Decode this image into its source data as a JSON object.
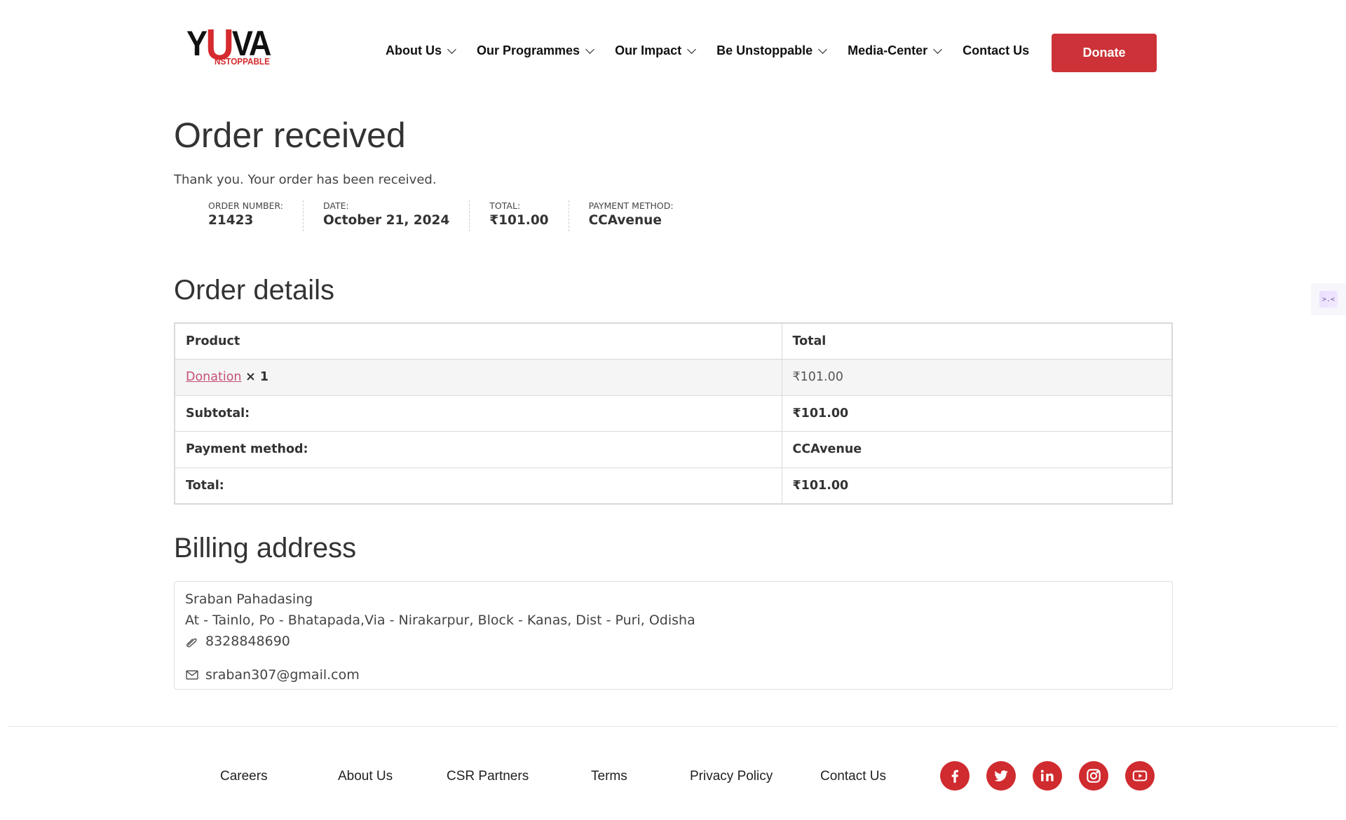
{
  "brand": {
    "logo_main": "YUVA",
    "logo_sub": "NSTOPPABLE",
    "accent_color": "#cc3237"
  },
  "nav": {
    "items": [
      {
        "label": "About Us",
        "dropdown": true
      },
      {
        "label": "Our Programmes",
        "dropdown": true
      },
      {
        "label": "Our Impact",
        "dropdown": true
      },
      {
        "label": "Be Unstoppable",
        "dropdown": true
      },
      {
        "label": "Media-Center",
        "dropdown": true
      },
      {
        "label": "Contact Us",
        "dropdown": false
      }
    ],
    "donate_label": "Donate"
  },
  "order": {
    "title": "Order received",
    "thanks": "Thank you. Your order has been received.",
    "overview": {
      "number_label": "ORDER NUMBER:",
      "number": "21423",
      "date_label": "DATE:",
      "date": "October 21, 2024",
      "total_label": "TOTAL:",
      "total": "₹101.00",
      "payment_label": "PAYMENT METHOD:",
      "payment": "CCAvenue"
    }
  },
  "details": {
    "heading": "Order details",
    "col_product": "Product",
    "col_total": "Total",
    "item": {
      "name": "Donation",
      "qty": "× 1",
      "total": "₹101.00"
    },
    "subtotal_label": "Subtotal:",
    "subtotal": "₹101.00",
    "payment_label": "Payment method:",
    "payment": "CCAvenue",
    "total_label": "Total:",
    "total": "₹101.00"
  },
  "billing": {
    "heading": "Billing address",
    "name": "Sraban Pahadasing",
    "address": "At - Tainlo, Po - Bhatapada,Via - Nirakarpur, Block - Kanas, Dist - Puri, Odisha",
    "phone": "8328848690",
    "email": "sraban307@gmail.com"
  },
  "side_widget": {
    "glyph": ">.<"
  },
  "footer": {
    "links": [
      "Careers",
      "About Us",
      "CSR Partners",
      "Terms",
      "Privacy Policy",
      "Contact Us"
    ],
    "social": [
      "facebook-icon",
      "twitter-icon",
      "linkedin-icon",
      "instagram-icon",
      "youtube-icon"
    ]
  }
}
